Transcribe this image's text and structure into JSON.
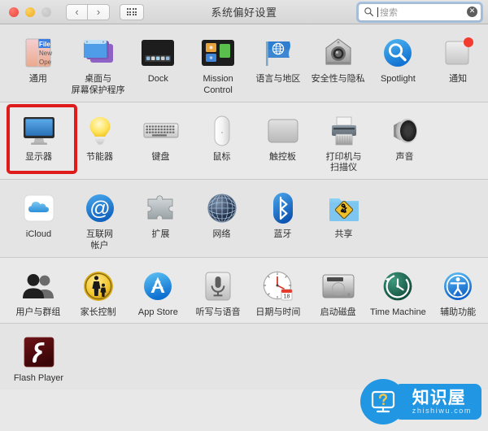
{
  "window": {
    "title": "系统偏好设置",
    "traffic_lights": [
      "close-red",
      "minimize-yellow",
      "zoom-disabled-grey"
    ],
    "nav": {
      "back_label": "‹",
      "forward_label": "›"
    },
    "grid_button_name": "show-all-grid-button"
  },
  "search": {
    "placeholder": "搜索",
    "value": "",
    "icon": "search-icon",
    "clear_icon": "clear-circle-icon",
    "clear_glyph": "✕",
    "accent": "#74a8e0"
  },
  "highlight": {
    "color": "#e01b1b",
    "target": "显示器"
  },
  "rows": [
    {
      "id": "row-personal",
      "items": [
        {
          "label": "通用",
          "icon": "general-file-icon"
        },
        {
          "label": "桌面与\n屏幕保护程序",
          "icon": "desktop-screensaver-icon"
        },
        {
          "label": "Dock",
          "icon": "dock-icon"
        },
        {
          "label": "Mission\nControl",
          "icon": "mission-control-icon"
        },
        {
          "label": "语言与地区",
          "icon": "language-region-flag-icon"
        },
        {
          "label": "安全性与隐私",
          "icon": "security-privacy-house-icon"
        },
        {
          "label": "Spotlight",
          "icon": "spotlight-magnifier-icon"
        },
        {
          "label": "通知",
          "icon": "notifications-icon"
        }
      ]
    },
    {
      "id": "row-hardware",
      "items": [
        {
          "label": "显示器",
          "icon": "displays-monitor-icon",
          "highlighted": true
        },
        {
          "label": "节能器",
          "icon": "energy-saver-bulb-icon"
        },
        {
          "label": "键盘",
          "icon": "keyboard-icon"
        },
        {
          "label": "鼠标",
          "icon": "mouse-icon"
        },
        {
          "label": "触控板",
          "icon": "trackpad-icon"
        },
        {
          "label": "打印机与\n扫描仪",
          "icon": "printers-scanners-icon"
        },
        {
          "label": "声音",
          "icon": "sound-speaker-icon"
        }
      ]
    },
    {
      "id": "row-internet",
      "items": [
        {
          "label": "iCloud",
          "icon": "icloud-icon"
        },
        {
          "label": "互联网\n帐户",
          "icon": "internet-accounts-at-icon"
        },
        {
          "label": "扩展",
          "icon": "extensions-puzzle-icon"
        },
        {
          "label": "网络",
          "icon": "network-globe-icon"
        },
        {
          "label": "蓝牙",
          "icon": "bluetooth-icon"
        },
        {
          "label": "共享",
          "icon": "sharing-folder-icon"
        }
      ]
    },
    {
      "id": "row-system",
      "items": [
        {
          "label": "用户与群组",
          "icon": "users-groups-icon"
        },
        {
          "label": "家长控制",
          "icon": "parental-controls-icon"
        },
        {
          "label": "App Store",
          "icon": "app-store-icon"
        },
        {
          "label": "听写与语音",
          "icon": "dictation-speech-mic-icon"
        },
        {
          "label": "日期与时间",
          "icon": "date-time-clock-icon"
        },
        {
          "label": "启动磁盘",
          "icon": "startup-disk-icon"
        },
        {
          "label": "Time Machine",
          "icon": "time-machine-icon"
        },
        {
          "label": "辅助功能",
          "icon": "accessibility-icon"
        }
      ]
    },
    {
      "id": "row-other",
      "items": [
        {
          "label": "Flash Player",
          "icon": "flash-player-icon"
        }
      ]
    }
  ],
  "watermark": {
    "brand_cn": "知识屋",
    "url": "zhishiwu.com",
    "color": "#2196e3",
    "icon": "monitor-question-icon"
  }
}
